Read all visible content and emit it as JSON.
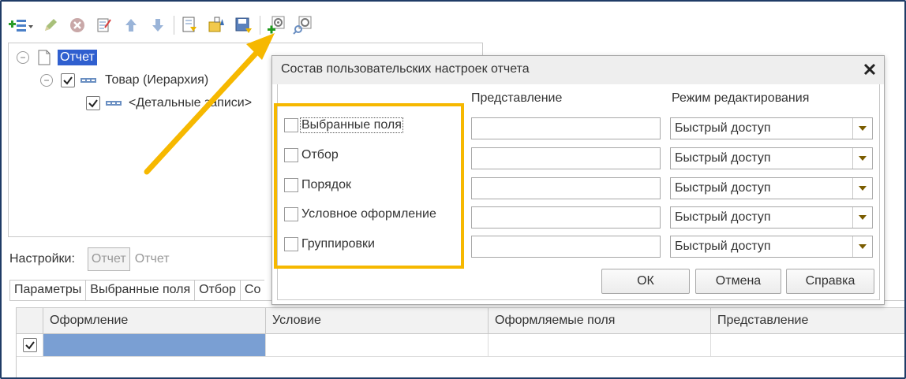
{
  "tree": {
    "root_label": "Отчет",
    "child_label": "Товар (Иерархия)",
    "grandchild_label": "<Детальные записи>"
  },
  "settings": {
    "label": "Настройки:",
    "button_label": "Отчет",
    "plain_label": "Отчет"
  },
  "tabs": [
    "Параметры",
    "Выбранные поля",
    "Отбор",
    "Со"
  ],
  "grid": {
    "columns": [
      "Оформление",
      "Условие",
      "Оформляемые поля",
      "Представление"
    ]
  },
  "dialog": {
    "title": "Состав пользовательских настроек отчета",
    "col_presentation": "Представление",
    "col_edit_mode": "Режим редактирования",
    "items": [
      {
        "label": "Выбранные поля",
        "checked": false,
        "presentation": "",
        "mode": "Быстрый доступ"
      },
      {
        "label": "Отбор",
        "checked": false,
        "presentation": "",
        "mode": "Быстрый доступ"
      },
      {
        "label": "Порядок",
        "checked": false,
        "presentation": "",
        "mode": "Быстрый доступ"
      },
      {
        "label": "Условное оформление",
        "checked": false,
        "presentation": "",
        "mode": "Быстрый доступ"
      },
      {
        "label": "Группировки",
        "checked": false,
        "presentation": "",
        "mode": "Быстрый доступ"
      }
    ],
    "ok_label": "ОК",
    "cancel_label": "Отмена",
    "help_label": "Справка"
  },
  "colors": {
    "accent": "#f6b800",
    "selection": "#2f5fcf",
    "frame": "#1f3b66"
  }
}
